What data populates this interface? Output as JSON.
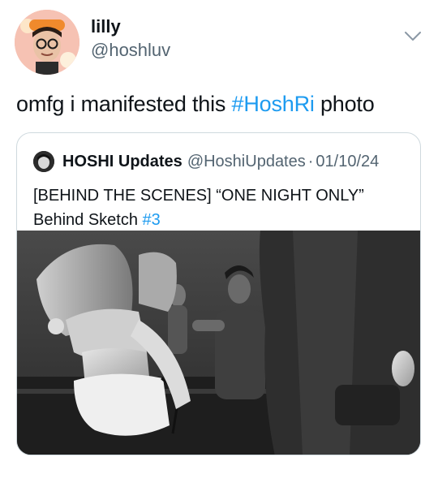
{
  "tweet": {
    "author": {
      "name": "lilly",
      "handle": "@hoshluv"
    },
    "text_parts": {
      "before": "omfg i manifested this ",
      "hashtag": "#HoshRi",
      "after": " photo"
    },
    "menu_icon": "chevron-down-icon"
  },
  "quote": {
    "author": {
      "name": "HOSHI Updates",
      "handle": "@HoshiUpdates",
      "separator": "·",
      "date": "01/10/24"
    },
    "text": {
      "line1": "[BEHIND THE SCENES] “ONE NIGHT ONLY”",
      "line2_before": "Behind Sketch ",
      "line2_hashtag": "#3"
    },
    "media": {
      "style": "black-and-white photo of dancers in a rehearsal studio"
    }
  },
  "colors": {
    "text": "#0f1419",
    "secondary": "#536471",
    "link": "#1d9bf0",
    "border": "#cfd9de"
  }
}
